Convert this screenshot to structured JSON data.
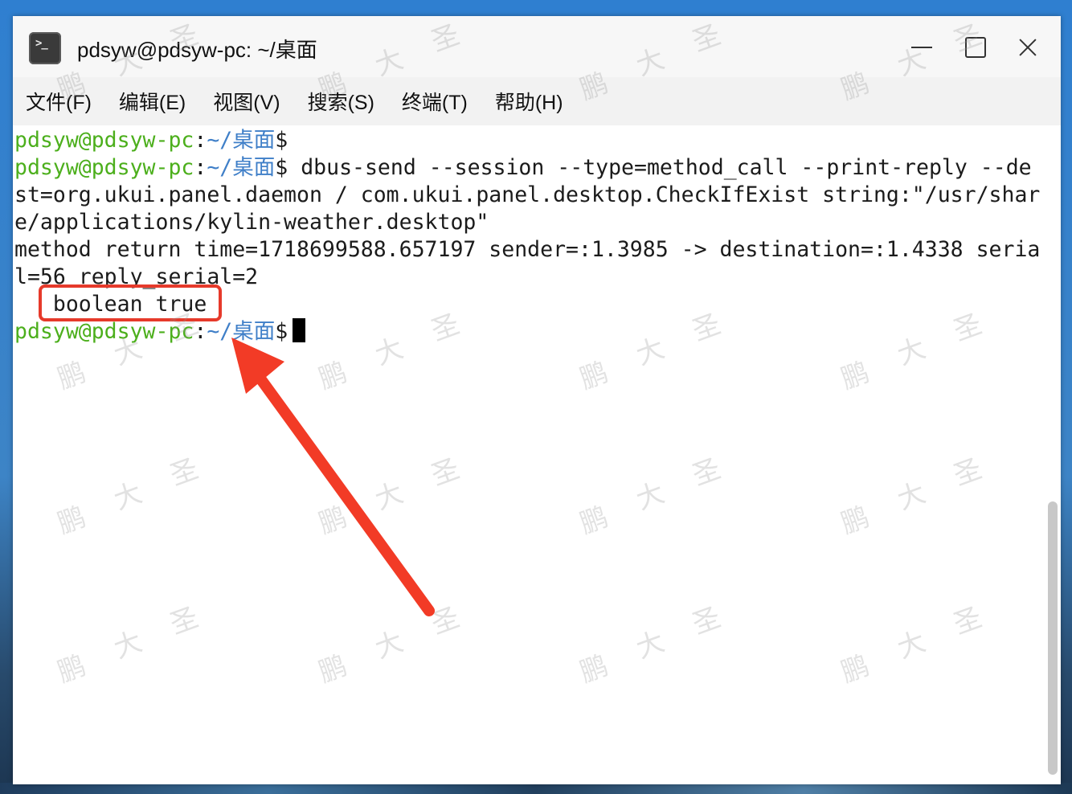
{
  "window": {
    "title": "pdsyw@pdsyw-pc: ~/桌面",
    "icon": "terminal-icon",
    "icon_glyph": ">_"
  },
  "menu": {
    "items": [
      "文件(F)",
      "编辑(E)",
      "视图(V)",
      "搜索(S)",
      "终端(T)",
      "帮助(H)"
    ]
  },
  "terminal": {
    "prompt_user": "pdsyw@pdsyw-pc",
    "prompt_sep": ":",
    "prompt_path": "~/桌面",
    "prompt_symbol": "$",
    "command": "dbus-send --session --type=method_call --print-reply --de",
    "wrapped_lines": [
      "st=org.ukui.panel.daemon / com.ukui.panel.desktop.CheckIfExist string:\"/usr/shar",
      "e/applications/kylin-weather.desktop\"",
      "method return time=1718699588.657197 sender=:1.3985 -> destination=:1.4338 seria",
      "l=56 reply_serial=2"
    ],
    "result": "   boolean true"
  },
  "watermark_text": "鹏 大 圣",
  "colors": {
    "prompt_user": "#4caf1c",
    "prompt_path": "#3f7fc8",
    "annotation": "#e63a2b"
  }
}
